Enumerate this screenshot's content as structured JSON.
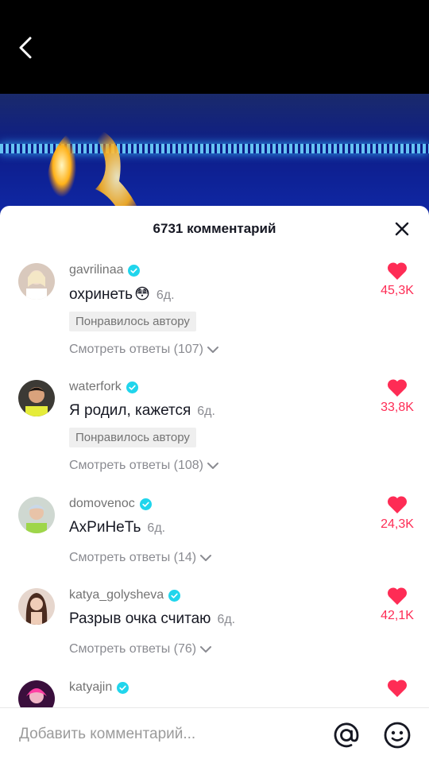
{
  "sheet": {
    "title": "6731 комментарий"
  },
  "comments": [
    {
      "username": "gavrilinaa",
      "text": "охринеть",
      "emoji": "😳",
      "age": "6д.",
      "liked_by_author": "Понравилось автору",
      "replies": "Смотреть ответы (107)",
      "likes": "45,3K"
    },
    {
      "username": "waterfork",
      "text": "Я родил, кажется",
      "age": "6д.",
      "liked_by_author": "Понравилось автору",
      "replies": "Смотреть ответы (108)",
      "likes": "33,8K"
    },
    {
      "username": "domovenoc",
      "text": "АхРиНеТь",
      "age": "6д.",
      "replies": "Смотреть ответы (14)",
      "likes": "24,3K"
    },
    {
      "username": "katya_golysheva",
      "text": "Разрыв очка считаю",
      "age": "6д.",
      "replies": "Смотреть ответы (76)",
      "likes": "42,1K"
    },
    {
      "username": "katyajin"
    }
  ],
  "composer": {
    "placeholder": "Добавить комментарий..."
  },
  "colors": {
    "like": "#fe2c55",
    "verified": "#20d5ec",
    "text": "#161823",
    "muted": "#8a8b91"
  }
}
